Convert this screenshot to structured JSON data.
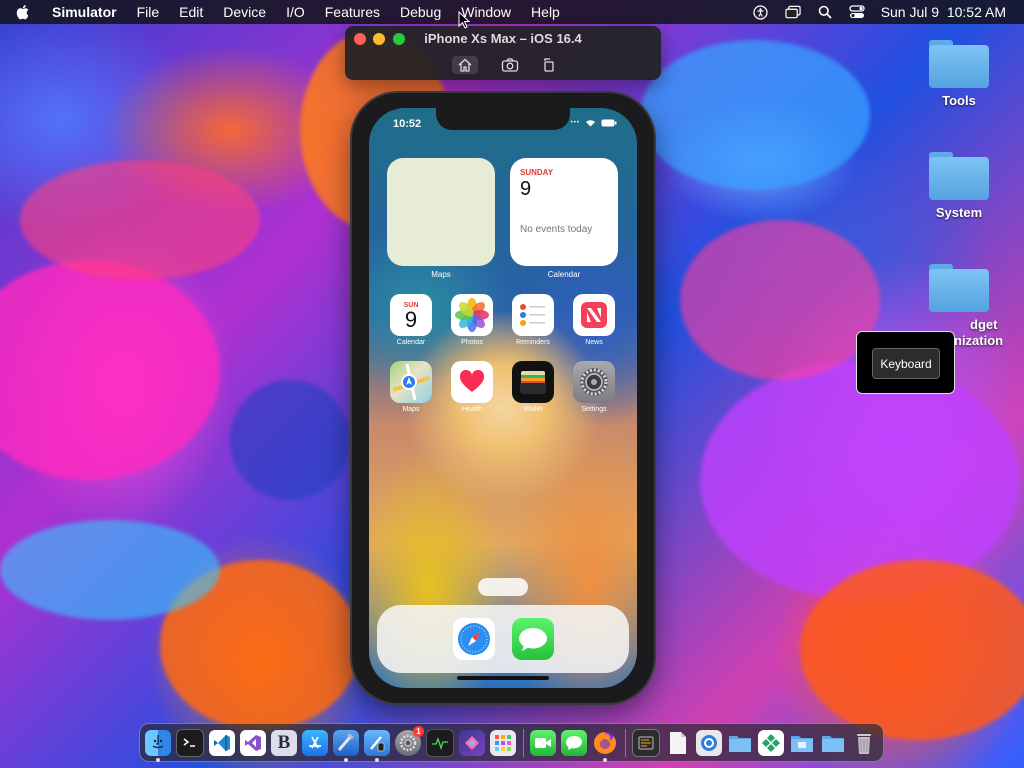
{
  "menubar": {
    "app_name": "Simulator",
    "items": [
      "File",
      "Edit",
      "Device",
      "I/O",
      "Features",
      "Debug",
      "Window",
      "Help"
    ],
    "clock": "Sun Jul 9  10:52 AM"
  },
  "simulator_window": {
    "title": "iPhone Xs Max – iOS 16.4"
  },
  "phone": {
    "status_time": "10:52",
    "widgets": {
      "maps_label": "Maps",
      "calendar_label": "Calendar",
      "calendar_day": "SUNDAY",
      "calendar_date": "9",
      "calendar_events": "No events today"
    },
    "apps": [
      {
        "label": "Calendar",
        "day": "SUN",
        "date": "9"
      },
      {
        "label": "Photos"
      },
      {
        "label": "Reminders"
      },
      {
        "label": "News"
      },
      {
        "label": "Maps"
      },
      {
        "label": "Health"
      },
      {
        "label": "Wallet"
      },
      {
        "label": "Settings"
      }
    ],
    "dock_apps": [
      "safari-icon",
      "messages-icon"
    ]
  },
  "desktop": {
    "icons": [
      {
        "label": "Tools"
      },
      {
        "label": "System"
      },
      {
        "label": "Widget Organization",
        "visible_label_top": "dget",
        "visible_label_bottom": "nization"
      }
    ]
  },
  "keyboard_popup": {
    "label": "Keyboard"
  },
  "mac_dock": {
    "apps": [
      "finder-icon",
      "terminal-icon",
      "vscode-icon",
      "visual-studio-icon",
      "bbedit-icon",
      "app-store-icon",
      "xcode-icon",
      "simulator-icon",
      "system-preferences-icon",
      "activity-monitor-icon",
      "affinity-icon",
      "launchpad-icon",
      "facetime-icon",
      "messages-icon",
      "firefox-icon",
      "console-icon",
      "file-icon",
      "safari-tech-icon",
      "folder-icon",
      "grid-app-icon",
      "folder-icon",
      "folder-icon",
      "trash-icon"
    ],
    "badge": "1",
    "bbedit_letter": "B"
  },
  "colors": {
    "menubar_bg": "#14141e",
    "traffic_red": "#ff5f57",
    "traffic_yellow": "#febc2e",
    "traffic_green": "#28c840",
    "calendar_red": "#e23b30"
  }
}
